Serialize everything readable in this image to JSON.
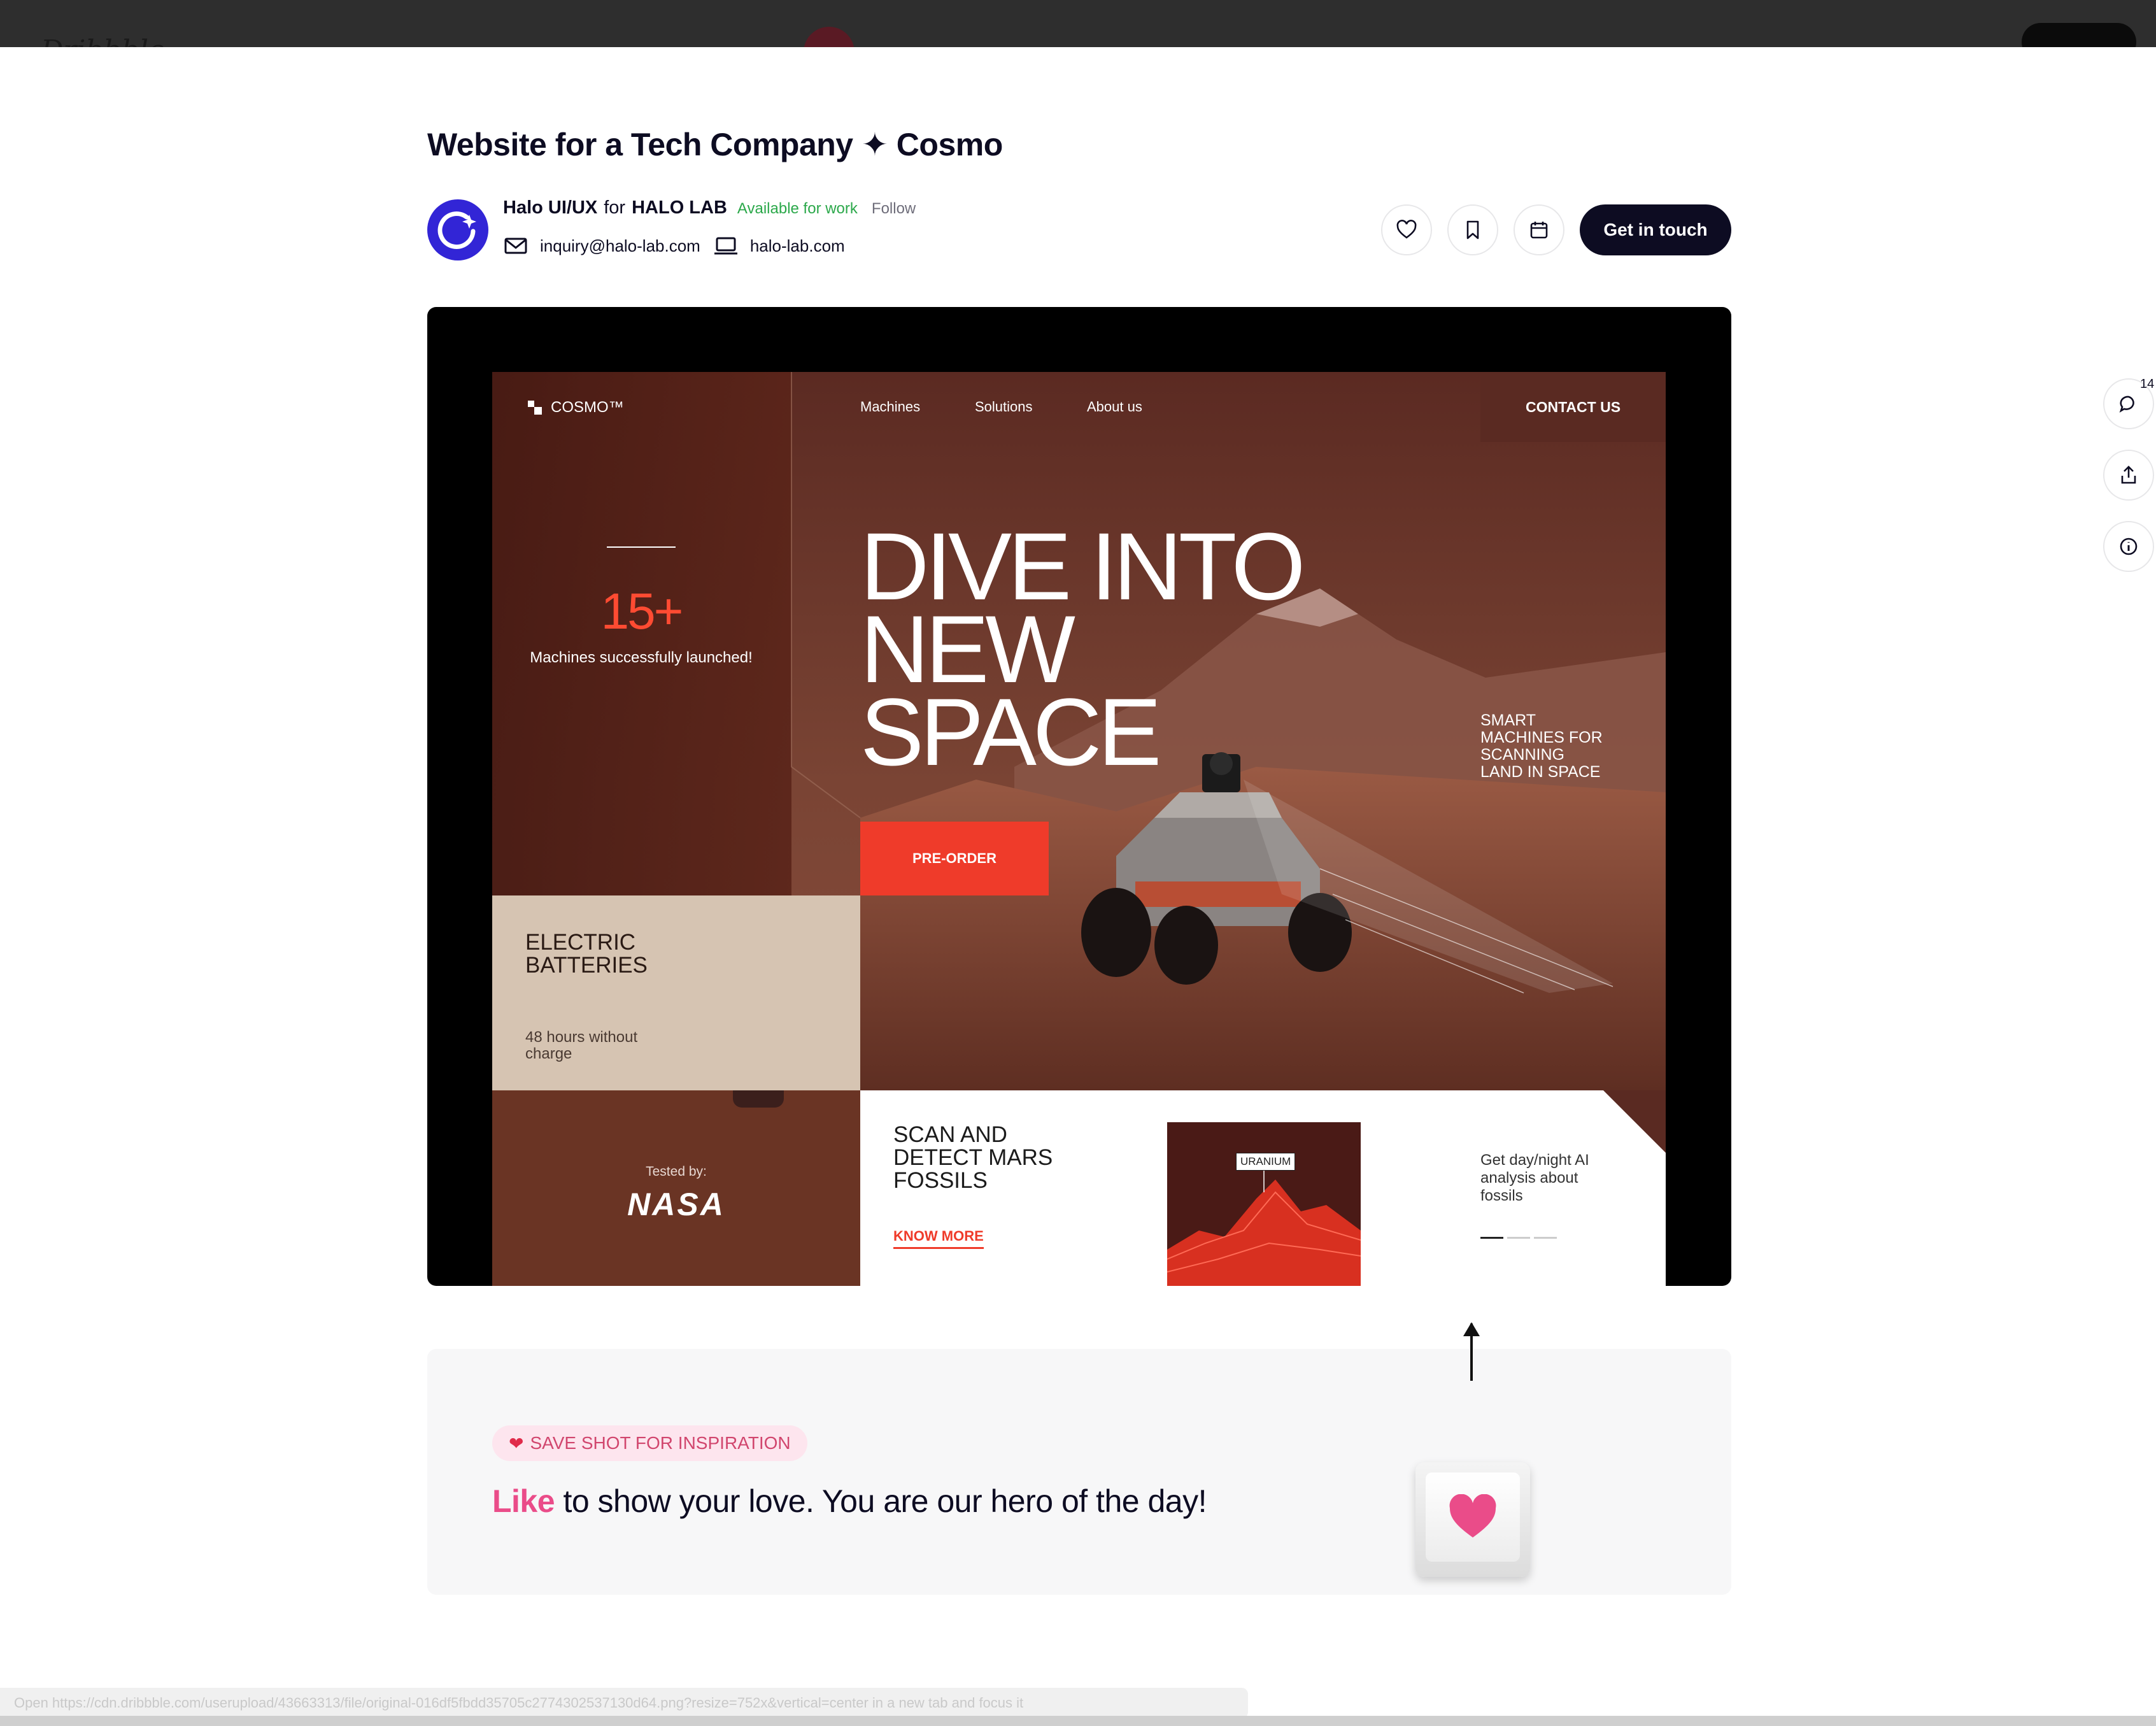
{
  "shot": {
    "title": "Website for a Tech Company ✦ Cosmo",
    "author_name": "Halo UI/UX",
    "for_word": "for",
    "team_name": "HALO LAB",
    "availability": "Available for work",
    "follow_label": "Follow",
    "email": "inquiry@halo-lab.com",
    "website": "halo-lab.com",
    "cta_label": "Get in touch",
    "comment_count": "14"
  },
  "cosmo": {
    "logo": "COSMO™",
    "nav": [
      "Machines",
      "Solutions",
      "About us"
    ],
    "contact": "CONTACT US",
    "stat_value": "15+",
    "stat_text": "Machines successfully launched!",
    "hero_lines": [
      "DIVE INTO",
      "NEW",
      "SPACE"
    ],
    "side_text": "SMART MACHINES FOR SCANNING LAND IN SPACE",
    "preorder": "PRE-ORDER",
    "battery_title": "ELECTRIC BATTERIES",
    "battery_sub": "48 hours without charge",
    "tested_by": "Tested by:",
    "nasa": "NASA",
    "scan_title": "SCAN AND DETECT MARS FOSSILS",
    "know_more": "KNOW MORE",
    "uranium": "URANIUM",
    "ai_text": "Get day/night AI analysis about fossils",
    "accent": "#ef3b2a"
  },
  "promo": {
    "badge": "SAVE SHOT FOR INSPIRATION",
    "like_word": "Like",
    "message_rest": " to show your love. You are our hero of the day!"
  },
  "status_url": "Open https://cdn.dribbble.com/userupload/43663313/file/original-016df5fbdd35705c2774302537130d64.png?resize=752x&vertical=center in a new tab and focus it"
}
